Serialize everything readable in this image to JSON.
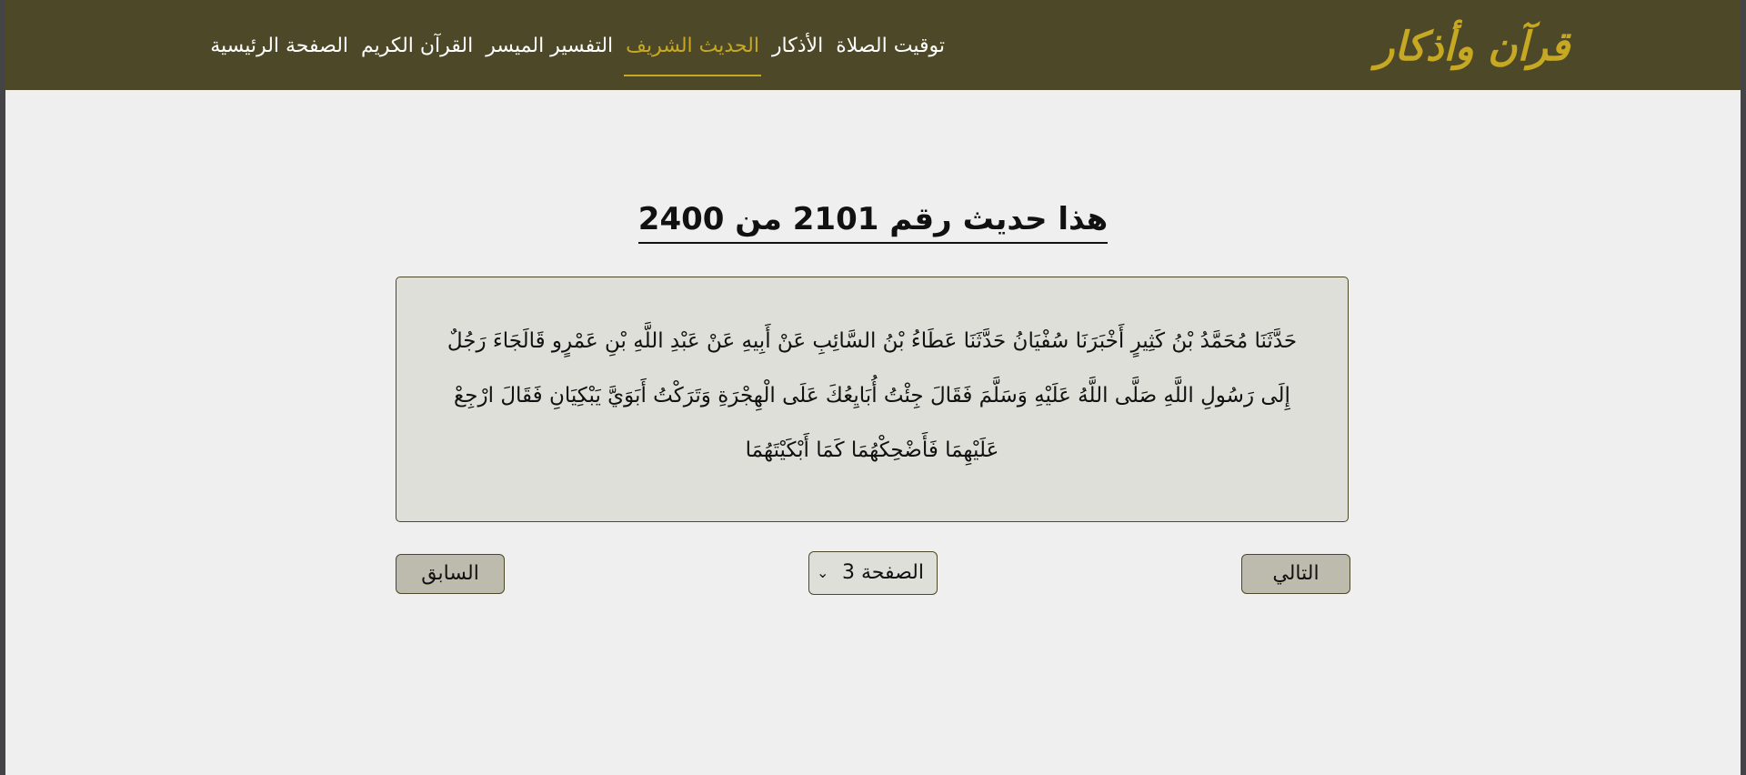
{
  "logo": "قرآن وأذكار",
  "nav": {
    "items": [
      {
        "label": "الصفحة الرئيسية"
      },
      {
        "label": "القرآن الكريم"
      },
      {
        "label": "التفسير الميسر"
      },
      {
        "label": "الحديث الشريف"
      },
      {
        "label": "الأذكار"
      },
      {
        "label": "توقيت الصلاة"
      }
    ],
    "active": "الحديث الشريف"
  },
  "heading": "هذا حديث رقم 2101 من 2400",
  "hadith": {
    "text": "حَدَّثَنَا مُحَمَّدُ بْنُ كَثِيرٍ أَخْبَرَنَا سُفْيَانُ حَدَّثَنَا عَطَاءُ بْنُ السَّائِبِ عَنْ أَبِيهِ عَنْ عَبْدِ اللَّهِ بْنِ عَمْرٍو قَالَجَاءَ رَجُلٌ إِلَى رَسُولِ اللَّهِ صَلَّى اللَّهُ عَلَيْهِ وَسَلَّمَ فَقَالَ جِئْتُ أُبَايِعُكَ عَلَى الْهِجْرَةِ وَتَرَكْتُ أَبَوَيَّ يَبْكِيَانِ فَقَالَ ارْجِعْ عَلَيْهِمَا فَأَضْحِكْهُمَا كَمَا أَبْكَيْتَهُمَا"
  },
  "pagination": {
    "next_label": "التالي",
    "prev_label": "السابق",
    "page_select_value": "الصفحة 3"
  },
  "icons": {
    "select_chevron": "chevron-down-icon"
  },
  "colors": {
    "navbar_bg": "#4d4928",
    "accent": "#c7a823",
    "box_bg": "#dfdfda",
    "button_bg": "#bcbbae"
  }
}
